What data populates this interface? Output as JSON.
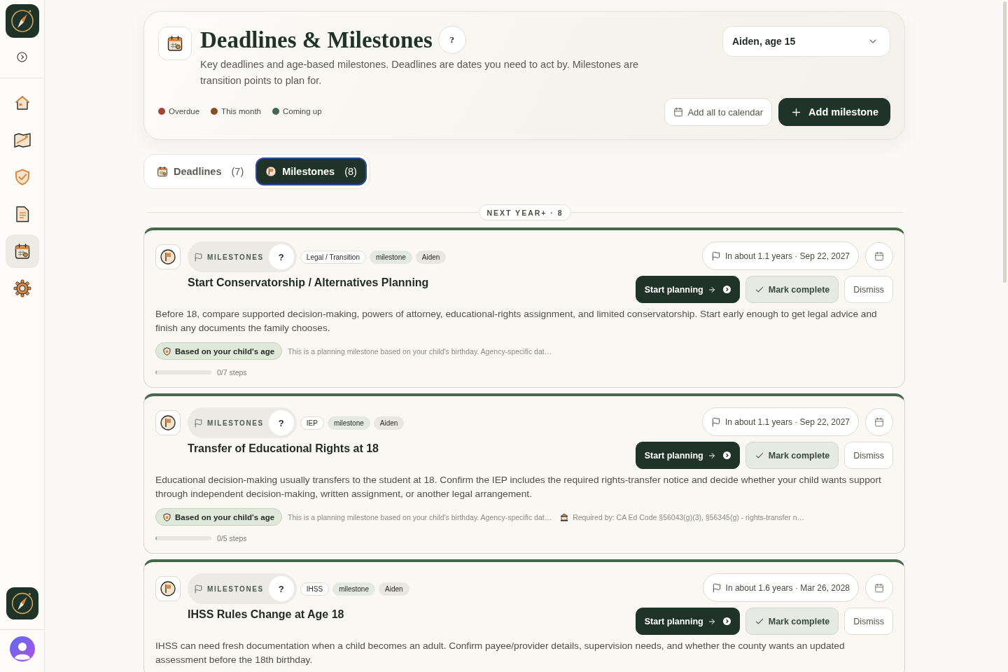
{
  "sidebar": {
    "nav": [
      {
        "kind": "home",
        "selected": false
      },
      {
        "kind": "map",
        "selected": false
      },
      {
        "kind": "shield",
        "selected": false
      },
      {
        "kind": "document",
        "selected": false
      },
      {
        "kind": "calendar",
        "selected": true
      },
      {
        "kind": "settings",
        "selected": false
      }
    ]
  },
  "header": {
    "title": "Deadlines & Milestones",
    "help": "?",
    "description": "Key deadlines and age-based milestones. Deadlines are dates you need to act by. Milestones are transition points to plan for.",
    "legend": [
      {
        "label": "Overdue",
        "color": "#a5453a"
      },
      {
        "label": "This month",
        "color": "#8a4b25"
      },
      {
        "label": "Coming up",
        "color": "#46684d"
      }
    ],
    "child_select": {
      "value": "Aiden, age 15"
    },
    "buttons": [
      {
        "label": "Add all to calendar",
        "kind": "secondary"
      },
      {
        "label": "Add milestone",
        "kind": "primary"
      }
    ]
  },
  "tabs": [
    {
      "label": "Deadlines",
      "count": "(7)",
      "kind": "deadlines",
      "selected": false
    },
    {
      "label": "Milestones",
      "count": "(8)",
      "kind": "milestones",
      "selected": true
    }
  ],
  "group": {
    "label": "NEXT YEAR+ · 8"
  },
  "cards": [
    {
      "category": "MILESTONES",
      "help": "?",
      "tags": [
        {
          "label": "Legal / Transition",
          "kind": "topic"
        },
        {
          "label": "milestone",
          "kind": "type"
        },
        {
          "label": "Aiden",
          "kind": "child"
        }
      ],
      "timing": "In about 1.1 years · Sep 22, 2027",
      "title": "Start Conservatorship / Alternatives Planning",
      "actions": [
        {
          "label": "Start planning",
          "kind": "primary"
        },
        {
          "label": "Mark complete",
          "kind": "complete"
        },
        {
          "label": "Dismiss",
          "kind": "dismiss"
        }
      ],
      "description": "Before 18, compare supported decision-making, powers of attorney, educational-rights assignment, and limited conservatorship. Start early enough to get legal advice and finish any documents the family chooses.",
      "basis": "Based on your child's age",
      "note": "This is a planning milestone based on your child's birthday. Agency-specific dat…",
      "progress": {
        "label": "0/7 steps",
        "level": 0
      }
    },
    {
      "category": "MILESTONES",
      "help": "?",
      "tags": [
        {
          "label": "IEP",
          "kind": "topic"
        },
        {
          "label": "milestone",
          "kind": "type"
        },
        {
          "label": "Aiden",
          "kind": "child"
        }
      ],
      "timing": "In about 1.1 years · Sep 22, 2027",
      "title": "Transfer of Educational Rights at 18",
      "actions": [
        {
          "label": "Start planning",
          "kind": "primary"
        },
        {
          "label": "Mark complete",
          "kind": "complete"
        },
        {
          "label": "Dismiss",
          "kind": "dismiss"
        }
      ],
      "description": "Educational decision-making usually transfers to the student at 18. Confirm the IEP includes the required rights-transfer notice and decide whether your child wants support through independent decision-making, written assignment, or another legal arrangement.",
      "basis": "Based on your child's age",
      "note": "This is a planning milestone based on your child's birthday. Agency-specific dat…",
      "requirement": "Required by: CA Ed Code §56043(g)(3), §56345(g) - rights-transfer n…",
      "progress": {
        "label": "0/5 steps",
        "level": 0
      }
    },
    {
      "category": "MILESTONES",
      "help": "?",
      "tags": [
        {
          "label": "IHSS",
          "kind": "topic"
        },
        {
          "label": "milestone",
          "kind": "type"
        },
        {
          "label": "Aiden",
          "kind": "child"
        }
      ],
      "timing": "In about 1.6 years · Mar 26, 2028",
      "title": "IHSS Rules Change at Age 18",
      "actions": [
        {
          "label": "Start planning",
          "kind": "primary"
        },
        {
          "label": "Mark complete",
          "kind": "complete"
        },
        {
          "label": "Dismiss",
          "kind": "dismiss"
        }
      ],
      "description": "IHSS can need fresh documentation when a child becomes an adult. Confirm payee/provider details, supervision needs, and whether the county wants an updated assessment before the 18th birthday."
    }
  ]
}
